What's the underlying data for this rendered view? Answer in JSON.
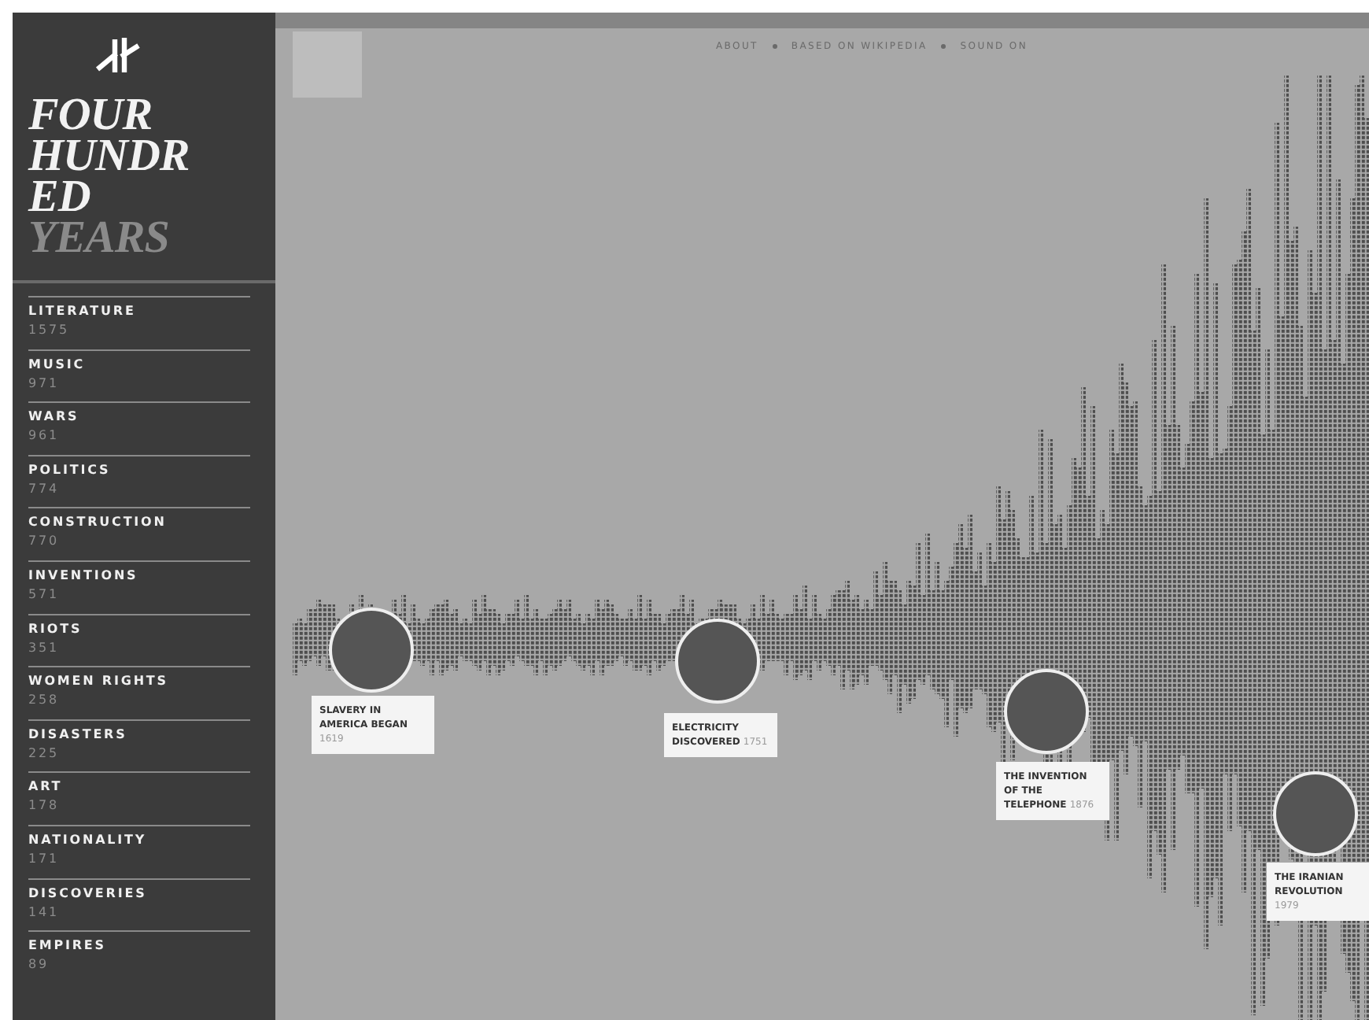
{
  "title": {
    "lines": [
      {
        "text": "FOUR",
        "muted": false
      },
      {
        "text": "HUNDR",
        "muted": false
      },
      {
        "text": "ED",
        "muted": false
      },
      {
        "text": "YEARS",
        "muted": true
      }
    ]
  },
  "categories": [
    {
      "name": "LITERATURE",
      "count": "1575"
    },
    {
      "name": "MUSIC",
      "count": "971"
    },
    {
      "name": "WARS",
      "count": "961"
    },
    {
      "name": "POLITICS",
      "count": "774"
    },
    {
      "name": "CONSTRUCTION",
      "count": "770"
    },
    {
      "name": "INVENTIONS",
      "count": "571"
    },
    {
      "name": "RIOTS",
      "count": "351"
    },
    {
      "name": "WOMEN RIGHTS",
      "count": "258"
    },
    {
      "name": "DISASTERS",
      "count": "225"
    },
    {
      "name": "ART",
      "count": "178"
    },
    {
      "name": "NATIONALITY",
      "count": "171"
    },
    {
      "name": "DISCOVERIES",
      "count": "141"
    },
    {
      "name": "EMPIRES",
      "count": "89"
    }
  ],
  "nav": [
    "ABOUT",
    "BASED ON WIKIPEDIA",
    "SOUND ON"
  ],
  "events": [
    {
      "title": "SLAVERY IN AMERICA BEGAN",
      "year": "1619"
    },
    {
      "title": "ELECTRICITY DISCOVERED",
      "year": "1751"
    },
    {
      "title": "THE INVENTION OF THE TELEPHONE",
      "year": "1876"
    },
    {
      "title": "THE IRANIAN REVOLUTION",
      "year": "1979"
    }
  ]
}
